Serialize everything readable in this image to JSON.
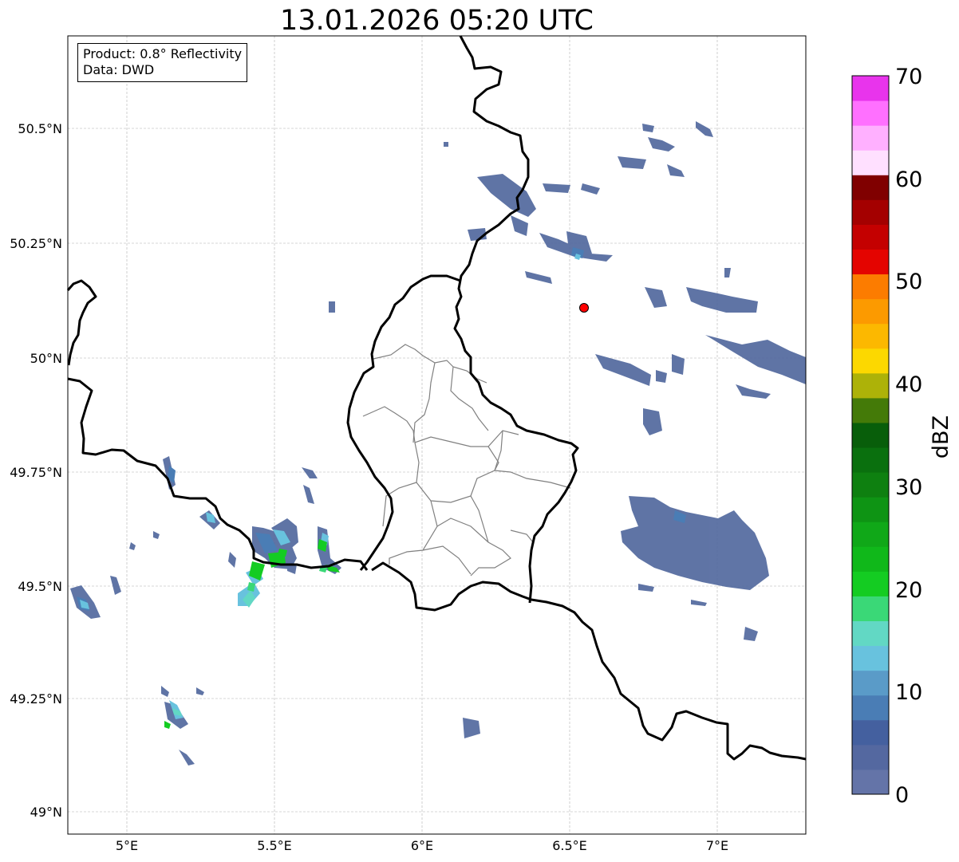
{
  "title": "13.01.2026 05:20 UTC",
  "info": {
    "product": "Product: 0.8° Reflectivity",
    "data": "Data: DWD"
  },
  "axes": {
    "x_ticks": [
      "5°E",
      "5.5°E",
      "6°E",
      "6.5°E",
      "7°E"
    ],
    "y_ticks": [
      "50.5°N",
      "50.25°N",
      "50°N",
      "49.75°N",
      "49.5°N",
      "49.25°N",
      "49°N"
    ]
  },
  "colorbar": {
    "label": "dBZ",
    "ticks": [
      "0",
      "10",
      "20",
      "30",
      "40",
      "50",
      "60",
      "70"
    ],
    "colors": [
      "#6474a8",
      "#5468a0",
      "#44609f",
      "#4a7db5",
      "#5a9bc8",
      "#68c2de",
      "#62d8c4",
      "#3ad877",
      "#14cc22",
      "#10b81a",
      "#10a818",
      "#0e9414",
      "#0e8010",
      "#0a700e",
      "#085e0a",
      "#447a08",
      "#adb208",
      "#fcd800",
      "#fcb800",
      "#fc9a00",
      "#fc7c00",
      "#e40400",
      "#c40000",
      "#a40000",
      "#800000",
      "#ffe0ff",
      "#ffb0ff",
      "#ff70ff",
      "#e834ec"
    ]
  },
  "marker": {
    "label": "radar-site",
    "color": "#ff0000"
  }
}
